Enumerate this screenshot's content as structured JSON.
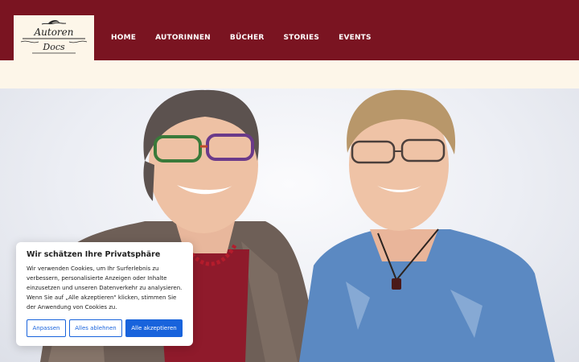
{
  "header": {
    "logo_line1": "Autoren",
    "logo_line2": "Docs",
    "nav": [
      "HOME",
      "AUTORINNEN",
      "BÜCHER",
      "STORIES",
      "EVENTS"
    ]
  },
  "hero": {
    "alt": "Zwei lächelnde Autorinnen"
  },
  "cookie": {
    "title": "Wir schätzen Ihre Privatsphäre",
    "text": "Wir verwenden Cookies, um Ihr Surferlebnis zu verbessern, personalisierte Anzeigen oder Inhalte einzusetzen und unseren Datenverkehr zu analysieren. Wenn Sie auf „Alle akzeptieren\" klicken, stimmen Sie der Anwendung von Cookies zu.",
    "btn_customize": "Anpassen",
    "btn_reject": "Alles ablehnen",
    "btn_accept": "Alle akzeptieren"
  },
  "colors": {
    "header_bg": "#7a1421",
    "strip_bg": "#fdf6e9",
    "accent_blue": "#1863dc"
  }
}
